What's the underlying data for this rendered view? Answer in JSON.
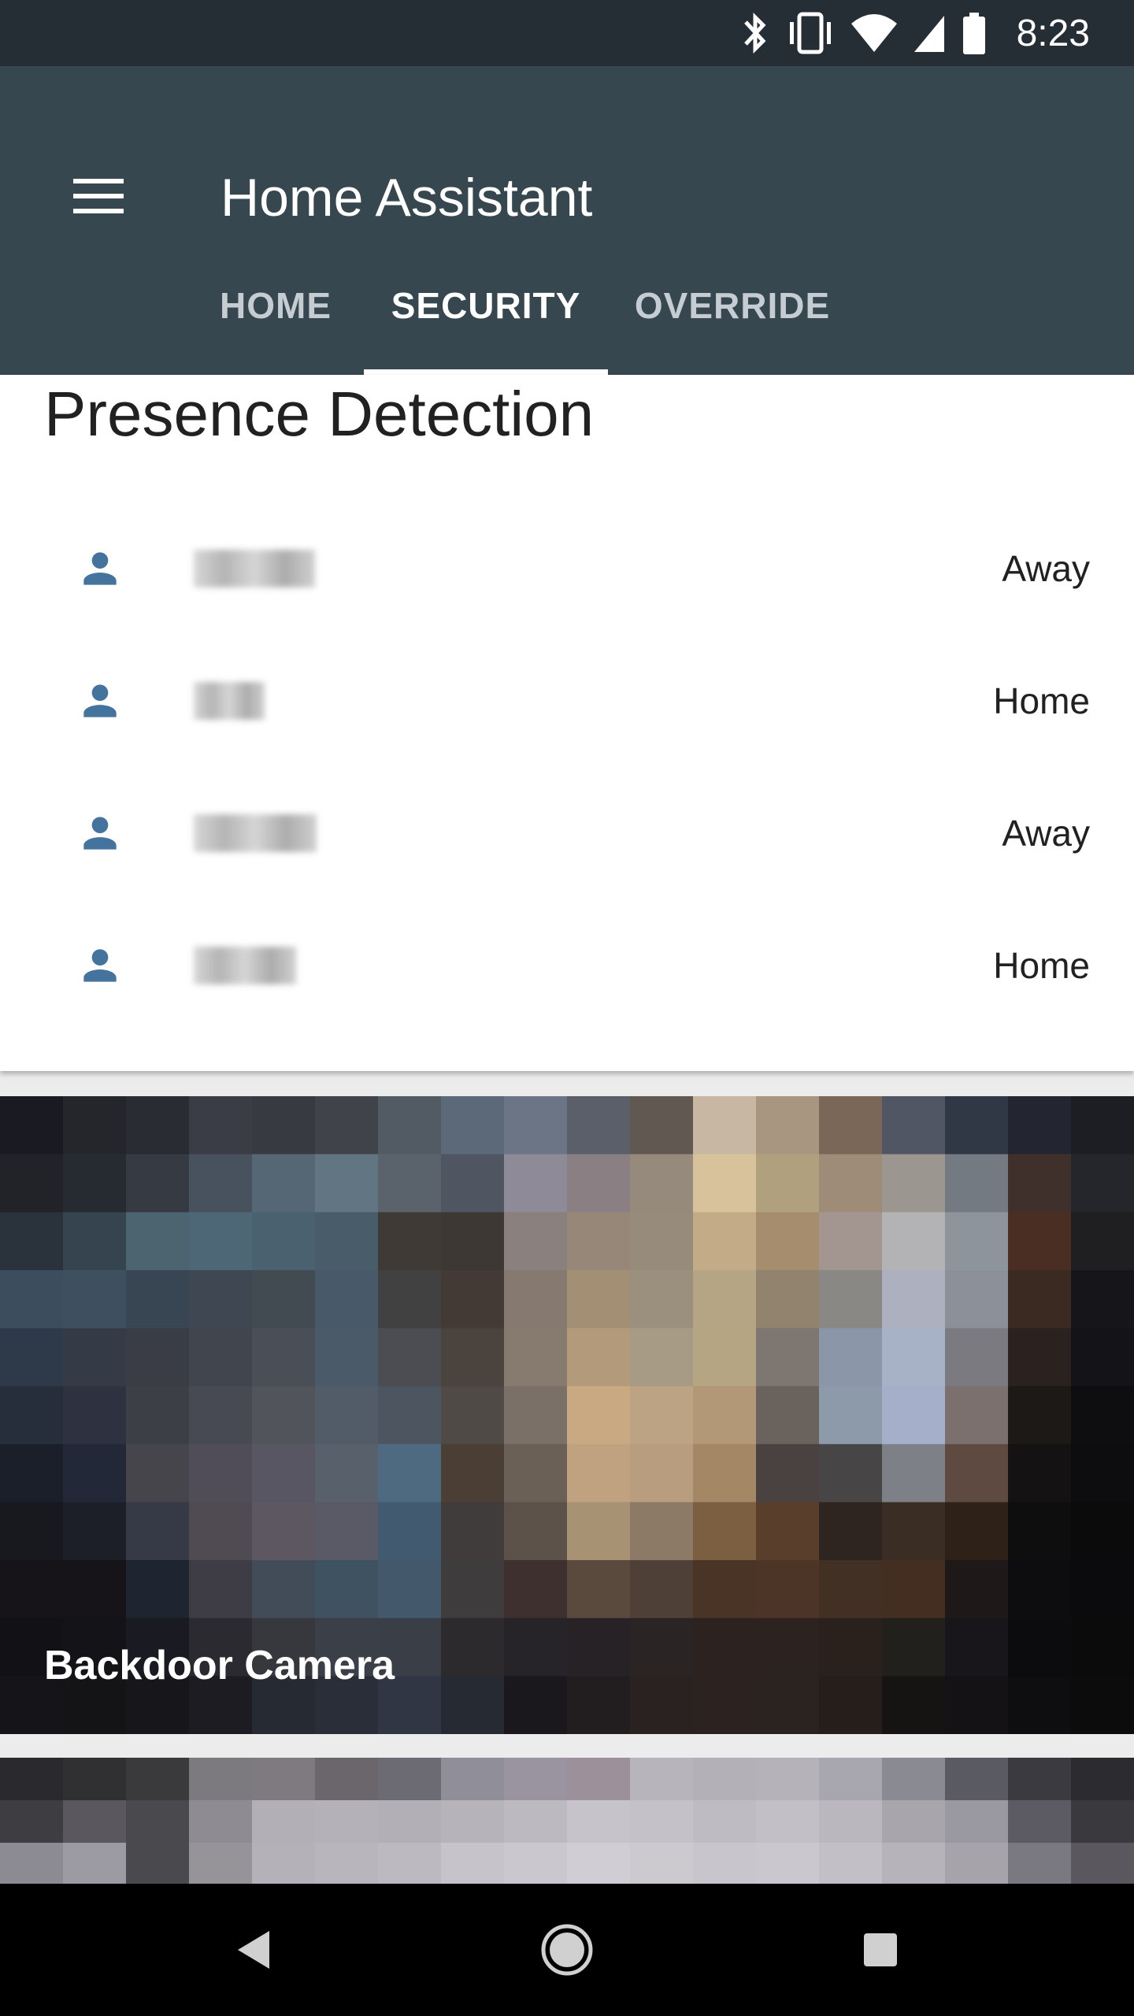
{
  "status_bar": {
    "time": "8:23",
    "icons": [
      "bluetooth-icon",
      "vibrate-icon",
      "wifi-icon",
      "cell-signal-icon",
      "battery-icon"
    ]
  },
  "app_bar": {
    "title": "Home Assistant",
    "menu_icon": "hamburger-menu-icon",
    "tabs": [
      {
        "label": "HOME",
        "active": false
      },
      {
        "label": "SECURITY",
        "active": true
      },
      {
        "label": "OVERRIDE",
        "active": false
      }
    ]
  },
  "presence_card": {
    "title": "Presence Detection",
    "people": [
      {
        "icon": "person-icon",
        "state": "Away"
      },
      {
        "icon": "person-icon",
        "state": "Home"
      },
      {
        "icon": "person-icon",
        "state": "Away"
      },
      {
        "icon": "person-icon",
        "state": "Home"
      }
    ]
  },
  "camera_card": {
    "title": "Backdoor Camera"
  },
  "colors": {
    "status_bar": "#262e35",
    "app_bar": "#37474f",
    "person_icon": "#44739e"
  },
  "nav_bar": {
    "icons": [
      "back-icon",
      "home-icon",
      "recents-icon"
    ]
  }
}
